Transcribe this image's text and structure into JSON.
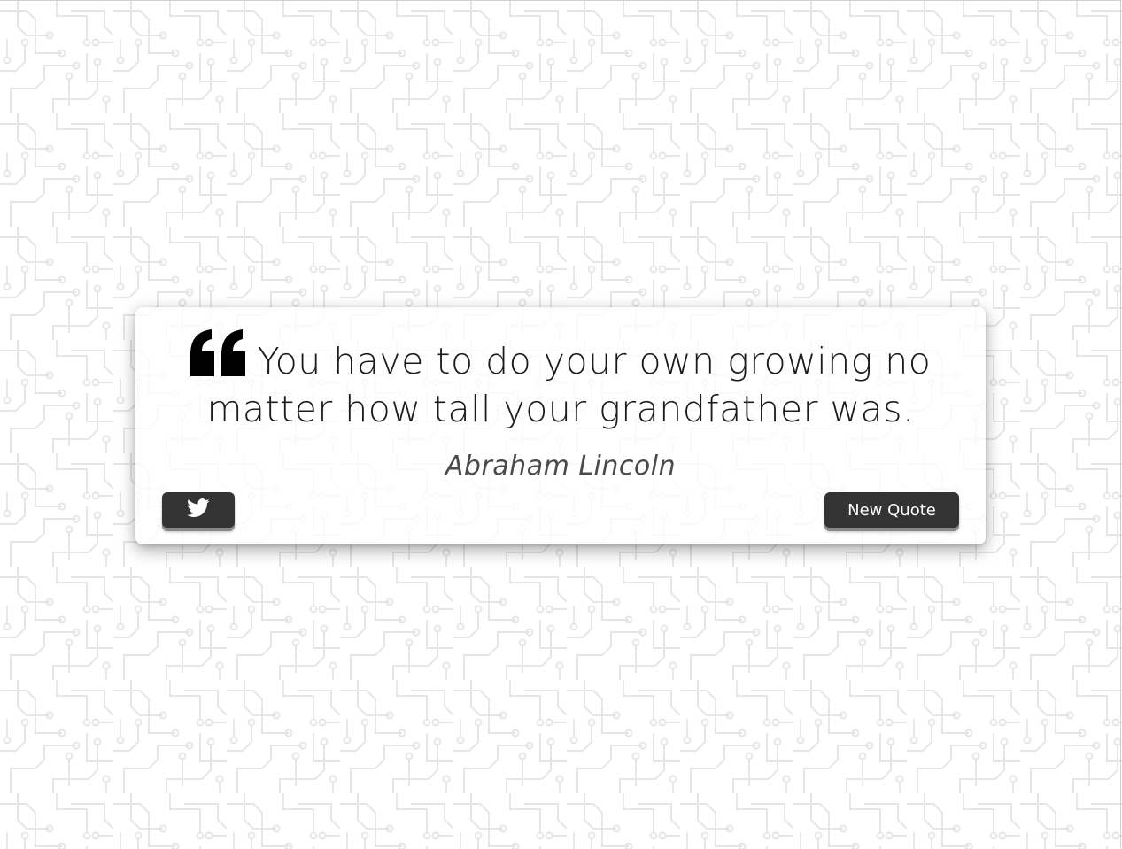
{
  "quote": {
    "text": "You have to do your own growing no matter how tall your grandfather was.",
    "author": "Abraham Lincoln"
  },
  "buttons": {
    "tweet_icon": "twitter-icon",
    "new_quote_label": "New Quote"
  },
  "icons": {
    "quote_mark": "quote-left-icon"
  },
  "colors": {
    "button_bg": "#333333",
    "button_text": "#ffffff",
    "quote_text": "#1b1b1b",
    "author_text": "#4a4a4a",
    "background": "#ffffff",
    "circuit_lines": "#e6e6e6"
  }
}
